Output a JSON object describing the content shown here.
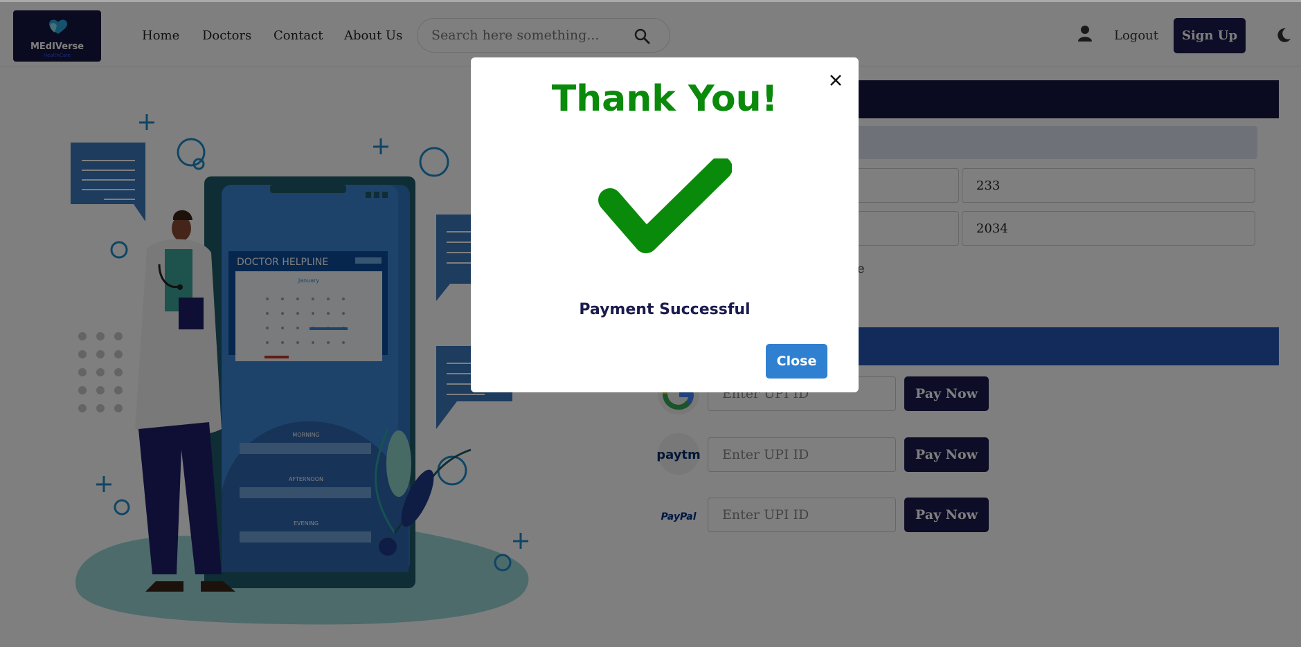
{
  "brand": {
    "title": "MEdIVerse",
    "subtitle": "HealthCare"
  },
  "nav": {
    "links": [
      "Home",
      "Doctors",
      "Contact",
      "About Us"
    ]
  },
  "search": {
    "placeholder": "Search here something..."
  },
  "auth": {
    "logout_label": "Logout",
    "signup_label": "Sign Up"
  },
  "illustration": {
    "helpline_title": "DOCTOR HELPLINE",
    "calendar_month": "January",
    "slots": [
      "MORNING",
      "AFTERNOON",
      "EVENING"
    ]
  },
  "card_form": {
    "cvv_value": "233",
    "year_value": "2034",
    "partial_text": "e"
  },
  "upi": {
    "placeholder": "Enter UPI ID",
    "pay_label": "Pay Now",
    "providers": [
      "google-pay",
      "paytm",
      "paypal"
    ],
    "paytm_label": "paytm",
    "paypal_label": "PayPal"
  },
  "modal": {
    "title": "Thank You!",
    "message": "Payment Successful",
    "close_label": "Close"
  },
  "colors": {
    "navy": "#1a1a4e",
    "success_green": "#0a8a0a",
    "close_blue": "#2f80d0",
    "bar_blue": "#2556b6"
  }
}
